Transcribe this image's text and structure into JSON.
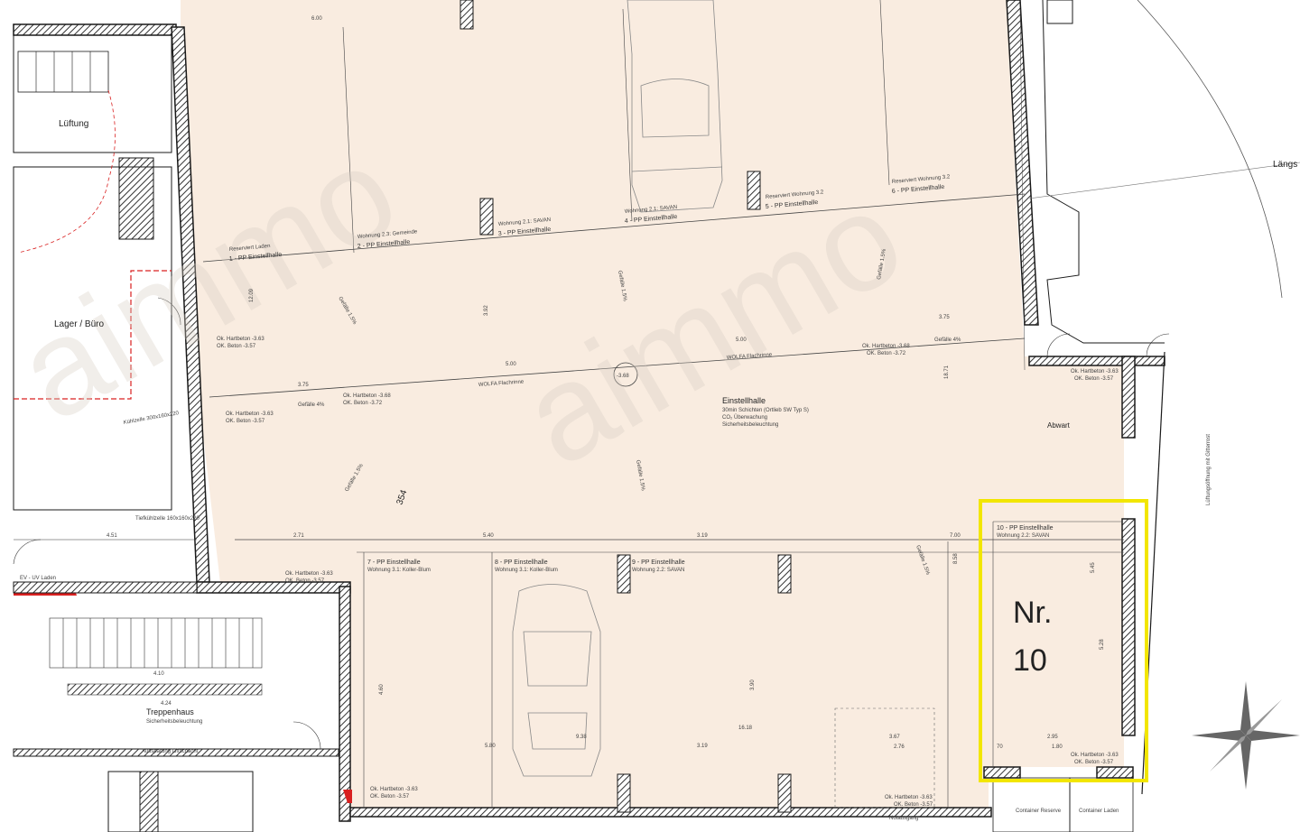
{
  "rooms": {
    "lueftung": "Lüftung",
    "lager": "Lager / Büro",
    "einstellhalle": "Einstellhalle",
    "einstellhalle_sub1": "30min Schichten (Ortlieb SW Typ S)",
    "einstellhalle_sub2": "CO₂ Überwachung",
    "einstellhalle_sub3": "Sicherheitsbeleuchtung",
    "treppenhaus": "Treppenhaus",
    "treppenhaus_sub": "Sicherheitsbeleuchtung",
    "abwart": "Abwart",
    "room_number": "354",
    "laengs": "Längs"
  },
  "parking_top": [
    {
      "title": "1 - PP Einstellhalle",
      "owner": "Reserviert Laden"
    },
    {
      "title": "2 - PP Einstellhalle",
      "owner": "Wohnung 2.3: Gemeinde"
    },
    {
      "title": "3 - PP Einstellhalle",
      "owner": "Wohnung 2.1: SAVAN"
    },
    {
      "title": "4 - PP Einstellhalle",
      "owner": "Wohnung 2.1: SAVAN"
    },
    {
      "title": "5 - PP Einstellhalle",
      "owner": "Reserviert Wohnung 3.2"
    },
    {
      "title": "6 - PP Einstellhalle",
      "owner": "Reserviert Wohnung 3.2"
    }
  ],
  "parking_bottom": [
    {
      "title": "7 - PP Einstellhalle",
      "owner": "Wohnung 3.1: Koller-Blum"
    },
    {
      "title": "8 - PP Einstellhalle",
      "owner": "Wohnung 3.1: Koller-Blum"
    },
    {
      "title": "9 - PP Einstellhalle",
      "owner": "Wohnung 2.2: SAVAN"
    }
  ],
  "highlight": {
    "title": "10 - PP Einstellhalle",
    "owner": "Wohnung 2.2: SAVAN",
    "label_line1": "Nr.",
    "label_line2": "10",
    "color": "#f2e600"
  },
  "flooring": {
    "hartbeton": "Ok. Hartbeton -3.63",
    "beton": "OK. Beton -3.57",
    "hartbeton2": "Ok. Hartbeton -3.68",
    "beton2": "OK. Beton -3.72",
    "gefaelle": "Gefälle 1.5%",
    "gefaelle4": "Gefälle 4%",
    "wolfa": "WOLFA Flachrinne",
    "point": "-3.68"
  },
  "dimensions": {
    "d600": "6.00",
    "d500a": "5.00",
    "d500b": "5.00",
    "d375a": "3.75",
    "d375b": "3.75",
    "d540": "5.40",
    "d319a": "3.19",
    "d319b": "3.19",
    "d580": "5.80",
    "d938": "9.38",
    "d1618": "16.18",
    "d451": "4.51",
    "d410": "4.10",
    "d424": "4.24",
    "d700": "7.00",
    "d295": "2.95",
    "d180": "1.80",
    "d70": "70",
    "d367": "3.67",
    "d276": "2.76",
    "d1209": "12.09",
    "d528": "5.28",
    "d545": "5.45",
    "d858": "8.58",
    "d1871": "18.71",
    "d392": "3.92",
    "d460": "4.60",
    "d390": "3.90",
    "d271": "2.71"
  },
  "misc": {
    "ev": "EV - UV Laden",
    "kuehlzelle": "Kühlzelle 300x160x220",
    "tiefkuehl": "Tiefkühlzelle 160x160x220",
    "aussparung": "Aussparung Liftschacht",
    "container1": "Container Reserve",
    "container2": "Container Laden",
    "lueftungsoeffnung": "Lüftungsöffnung mit Gitterrost",
    "notausgang": "Notausgang"
  },
  "colors": {
    "hall": "#f9ece0",
    "wall": "#1a1a1a",
    "hatch": "#555555",
    "red": "#d92020",
    "line": "#333333"
  }
}
